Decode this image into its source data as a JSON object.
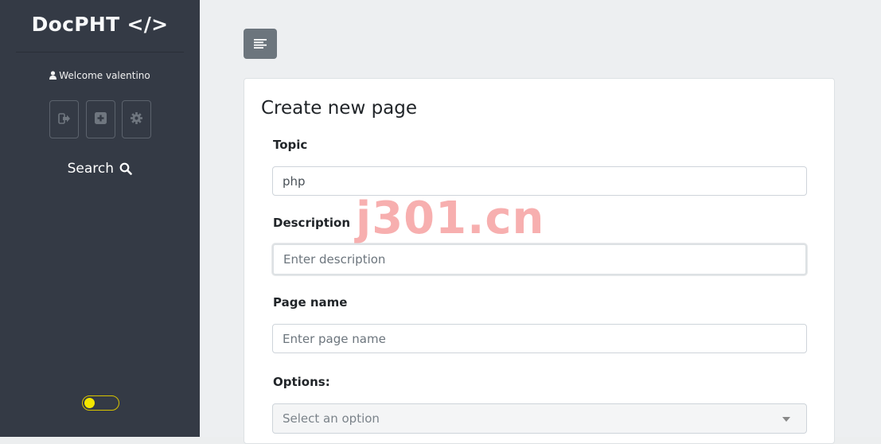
{
  "sidebar": {
    "brand": "DocPHT </>",
    "welcome": "Welcome valentino",
    "buttons": [
      {
        "icon": "sign-out-icon"
      },
      {
        "icon": "plus-square-icon"
      },
      {
        "icon": "gear-icon"
      }
    ],
    "search_label": "Search",
    "theme_toggle": {
      "state": "off",
      "knob_color": "#f3e600"
    }
  },
  "main": {
    "menu_button_icon": "align-left-icon",
    "form": {
      "title": "Create new page",
      "topic": {
        "label": "Topic",
        "value": "php"
      },
      "description": {
        "label": "Description",
        "value": "",
        "placeholder": "Enter description"
      },
      "page_name": {
        "label": "Page name",
        "value": "",
        "placeholder": "Enter page name"
      },
      "options": {
        "label": "Options:",
        "placeholder": "Select an option"
      }
    }
  },
  "watermark": "j301.cn",
  "colors": {
    "sidebar_bg": "#343a45",
    "main_bg": "#edeff1",
    "menu_button_bg": "#6c757d"
  }
}
